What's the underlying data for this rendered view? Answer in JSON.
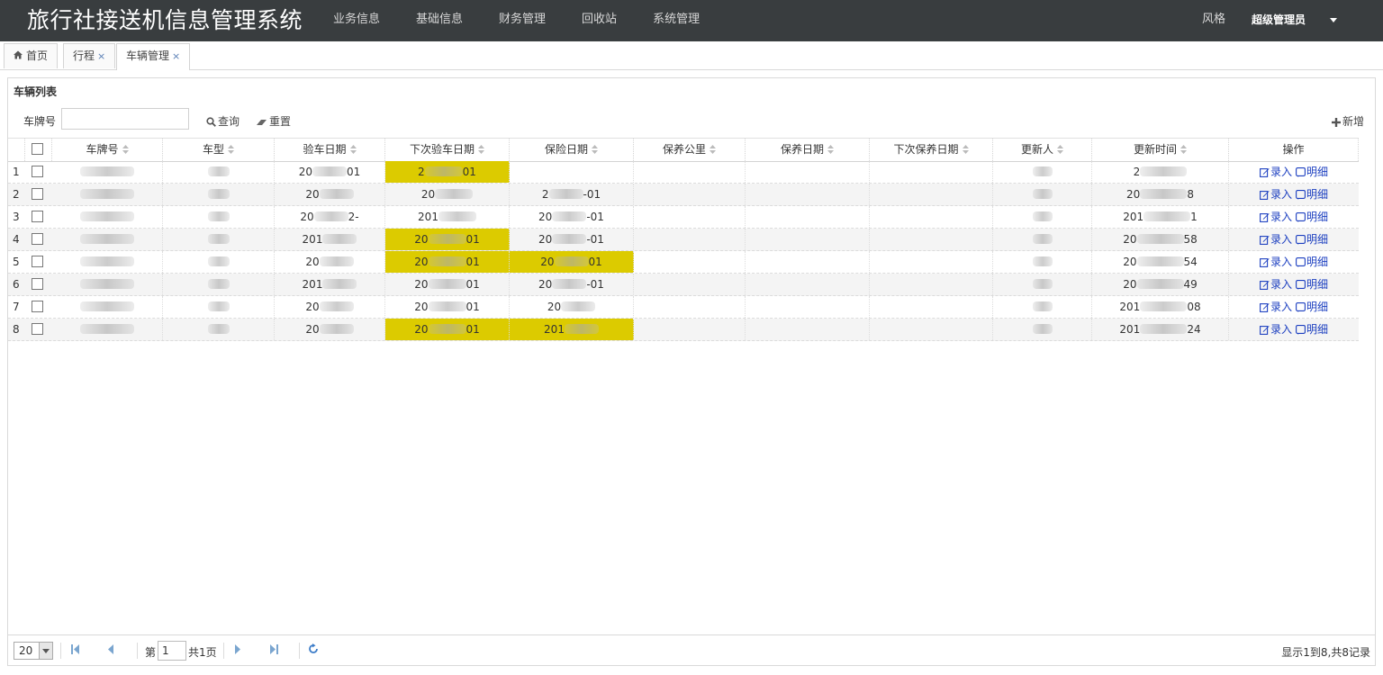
{
  "header": {
    "title": "旅行社接送机信息管理系统",
    "menu": [
      "业务信息",
      "基础信息",
      "财务管理",
      "回收站",
      "系统管理"
    ],
    "style_label": "风格",
    "user_label": "超级管理员"
  },
  "tabs": [
    {
      "label": "首页",
      "closable": false
    },
    {
      "label": "行程",
      "closable": true
    },
    {
      "label": "车辆管理",
      "closable": true,
      "active": true
    }
  ],
  "tab_close": "×",
  "panel": {
    "title": "车辆列表",
    "search_label": "车牌号",
    "search_value": "",
    "query_label": "查询",
    "reset_label": "重置",
    "add_label": "新增"
  },
  "grid": {
    "columns": [
      "车牌号",
      "车型",
      "验车日期",
      "下次验车日期",
      "保险日期",
      "保养公里",
      "保养日期",
      "下次保养日期",
      "更新人",
      "更新时间",
      "操作"
    ],
    "ops": {
      "edit": "录入",
      "detail": "明细"
    },
    "rows": [
      {
        "num": "1",
        "inspect": "20",
        "inspect_tail": "01",
        "next_inspect": "2",
        "next_inspect_tail": "01",
        "insurance": "",
        "insurance_tail": "",
        "updated": "2",
        "updated_tail": ""
      },
      {
        "num": "2",
        "inspect": "20",
        "inspect_tail": "",
        "next_inspect": "20",
        "next_inspect_tail": "",
        "insurance": "2",
        "insurance_tail": "-01",
        "updated": "20",
        "updated_tail": "8"
      },
      {
        "num": "3",
        "inspect": "20",
        "inspect_tail": "2-",
        "next_inspect": "201",
        "next_inspect_tail": "",
        "insurance": "20",
        "insurance_tail": "-01",
        "updated": "201",
        "updated_tail": "1"
      },
      {
        "num": "4",
        "inspect": "201",
        "inspect_tail": "",
        "next_inspect": "20",
        "next_inspect_tail": "01",
        "insurance": "20",
        "insurance_tail": "-01",
        "updated": "20",
        "updated_tail": "58"
      },
      {
        "num": "5",
        "inspect": "20",
        "inspect_tail": "",
        "next_inspect": "20",
        "next_inspect_tail": "01",
        "insurance": "20",
        "insurance_tail": "01",
        "updated": "20",
        "updated_tail": "54"
      },
      {
        "num": "6",
        "inspect": "201",
        "inspect_tail": "",
        "next_inspect": "20",
        "next_inspect_tail": "01",
        "insurance": "20",
        "insurance_tail": "-01",
        "updated": "20",
        "updated_tail": "49"
      },
      {
        "num": "7",
        "inspect": "20",
        "inspect_tail": "",
        "next_inspect": "20",
        "next_inspect_tail": "01",
        "insurance": "20",
        "insurance_tail": "",
        "updated": "201",
        "updated_tail": "08"
      },
      {
        "num": "8",
        "inspect": "20",
        "inspect_tail": "",
        "next_inspect": "20",
        "next_inspect_tail": "01",
        "insurance": "201",
        "insurance_tail": "",
        "updated": "201",
        "updated_tail": "24"
      }
    ],
    "highlight": {
      "next_inspect": [
        true,
        false,
        false,
        true,
        true,
        false,
        false,
        true
      ],
      "insurance": [
        false,
        false,
        false,
        false,
        true,
        false,
        false,
        true
      ]
    },
    "highlight_color": "#dccb00"
  },
  "pager": {
    "page_size": "20",
    "page_prefix": "第",
    "page_value": "1",
    "page_suffix": "共1页",
    "info": "显示1到8,共8记录"
  },
  "colors": {
    "topbar": "#393d3f",
    "link": "#1c3fc0"
  }
}
